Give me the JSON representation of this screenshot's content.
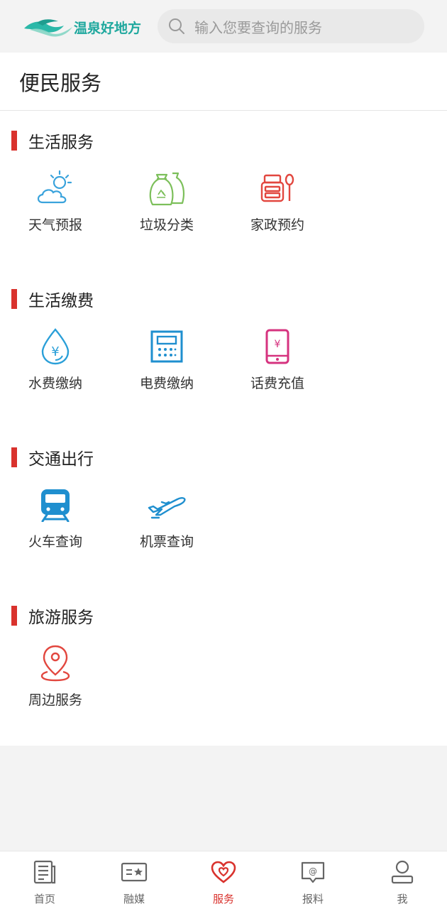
{
  "header": {
    "logo_text": "温泉好地方",
    "search_placeholder": "输入您要查询的服务"
  },
  "page": {
    "title": "便民服务"
  },
  "sections": [
    {
      "title": "生活服务",
      "items": [
        {
          "label": "天气预报",
          "icon": "weather-icon"
        },
        {
          "label": "垃圾分类",
          "icon": "garbage-sort-icon"
        },
        {
          "label": "家政预约",
          "icon": "housekeeping-icon"
        }
      ]
    },
    {
      "title": "生活缴费",
      "items": [
        {
          "label": "水费缴纳",
          "icon": "water-bill-icon"
        },
        {
          "label": "电费缴纳",
          "icon": "electric-bill-icon"
        },
        {
          "label": "话费充值",
          "icon": "phone-recharge-icon"
        }
      ]
    },
    {
      "title": "交通出行",
      "items": [
        {
          "label": "火车查询",
          "icon": "train-icon"
        },
        {
          "label": "机票查询",
          "icon": "plane-icon"
        }
      ]
    },
    {
      "title": "旅游服务",
      "items": [
        {
          "label": "周边服务",
          "icon": "location-pin-icon"
        }
      ]
    }
  ],
  "tabbar": {
    "tabs": [
      {
        "label": "首页",
        "icon": "news-icon"
      },
      {
        "label": "融媒",
        "icon": "media-icon"
      },
      {
        "label": "服务",
        "icon": "heart-icon",
        "active": true
      },
      {
        "label": "报料",
        "icon": "report-icon"
      },
      {
        "label": "我",
        "icon": "user-icon"
      }
    ]
  },
  "colors": {
    "accent": "#d9322d",
    "logo": "#1fa89e",
    "weather": "#3aa3dc",
    "garbage": "#7cbf5a",
    "housekeeping": "#e2473f",
    "water": "#2a9fd8",
    "electric": "#1f8fcf",
    "phone": "#d6337f",
    "travel": "#e2473f"
  }
}
